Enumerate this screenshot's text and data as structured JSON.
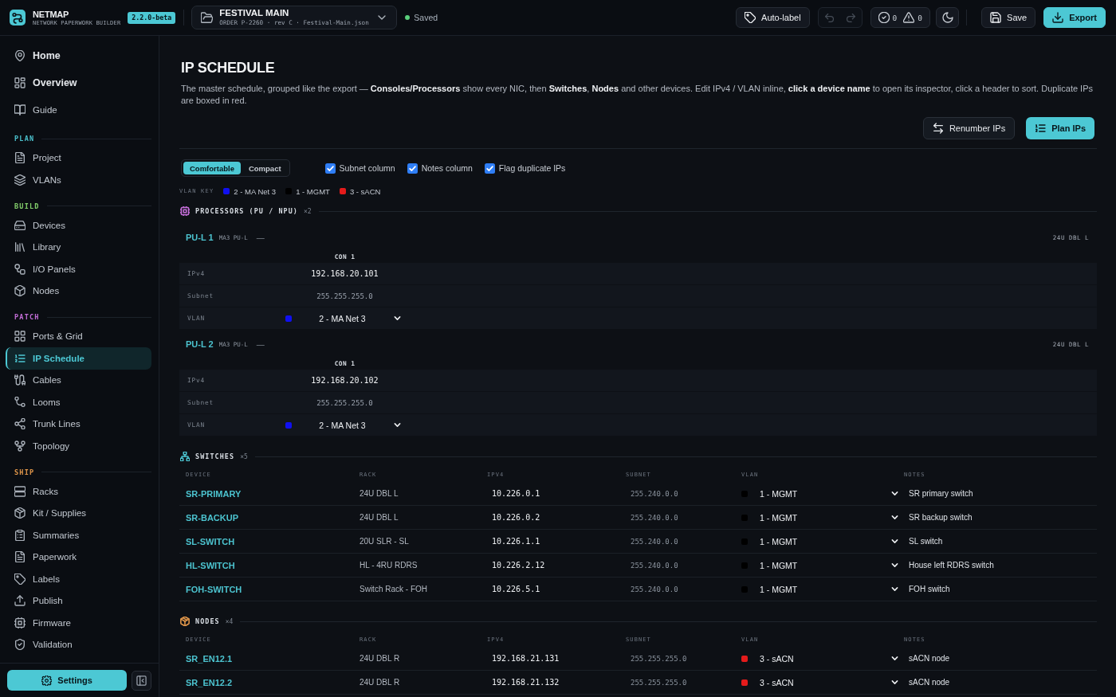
{
  "app_header": {
    "brand": {
      "name": "NETMAP",
      "tagline": "NETWORK PAPERWORK BUILDER",
      "version": "2.2.0-beta"
    },
    "project": {
      "title": "FESTIVAL MAIN",
      "details": "ORDER P-2260 · rev C · Festival-Main.json"
    },
    "save_status": {
      "label": "Saved",
      "saved": true
    },
    "actions": {
      "auto_label": "Auto-label",
      "undo": {
        "disabled": true
      },
      "redo": {
        "disabled": true
      },
      "checks": {
        "passed": "0",
        "warnings": "0"
      },
      "save": "Save",
      "export": "Export"
    }
  },
  "sidebar": {
    "top_items": [
      {
        "label": "Home",
        "kind": "primary",
        "selected": false
      },
      {
        "label": "Overview",
        "kind": "primary",
        "selected": false
      },
      {
        "label": "Guide",
        "kind": "secondary",
        "selected": false
      }
    ],
    "groups": [
      {
        "title": "PLAN",
        "color": "#4cc3cf",
        "items": [
          {
            "label": "Project",
            "selected": false
          },
          {
            "label": "VLANs",
            "selected": false
          }
        ]
      },
      {
        "title": "BUILD",
        "color": "#84d06c",
        "items": [
          {
            "label": "Devices",
            "selected": false
          },
          {
            "label": "Library",
            "selected": false
          },
          {
            "label": "I/O Panels",
            "selected": false
          },
          {
            "label": "Nodes",
            "selected": false
          }
        ]
      },
      {
        "title": "PATCH",
        "color": "#c46ed8",
        "items": [
          {
            "label": "Ports & Grid",
            "selected": false
          },
          {
            "label": "IP Schedule",
            "selected": true
          },
          {
            "label": "Cables",
            "selected": false
          },
          {
            "label": "Looms",
            "selected": false
          },
          {
            "label": "Trunk Lines",
            "selected": false
          },
          {
            "label": "Topology",
            "selected": false
          }
        ]
      },
      {
        "title": "SHIP",
        "color": "#e0964a",
        "items": [
          {
            "label": "Racks",
            "selected": false
          },
          {
            "label": "Kit / Supplies",
            "selected": false
          },
          {
            "label": "Summaries",
            "selected": false
          },
          {
            "label": "Paperwork",
            "selected": false
          },
          {
            "label": "Labels",
            "selected": false
          },
          {
            "label": "Publish",
            "selected": false
          },
          {
            "label": "Firmware",
            "selected": false
          },
          {
            "label": "Validation",
            "selected": false
          }
        ]
      }
    ],
    "settings": "Settings"
  },
  "page": {
    "title": "IP SCHEDULE",
    "description": "The master schedule, grouped like the export — **Consoles/Processors** show every NIC, then **Switches**, **Nodes** and other devices. Edit IPv4 / VLAN inline, **click a device name** to open its inspector, click a header to sort. Duplicate IPs are boxed in red.",
    "actions": [
      {
        "label": "Renumber IPs",
        "kind": "secondary"
      },
      {
        "label": "Plan IPs",
        "kind": "primary"
      }
    ]
  },
  "view_options": {
    "density": [
      {
        "label": "Comfortable",
        "selected": true
      },
      {
        "label": "Compact",
        "selected": false
      }
    ],
    "toggles": [
      {
        "label": "Subnet column",
        "checked": true
      },
      {
        "label": "Notes column",
        "checked": true
      },
      {
        "label": "Flag duplicate IPs",
        "checked": true
      }
    ]
  },
  "vlan_key": {
    "label": "VLAN KEY",
    "items": [
      {
        "label": "2 - MA Net 3",
        "color": "#1010f0"
      },
      {
        "label": "1 - MGMT",
        "color": "#000000"
      },
      {
        "label": "3 - sACN",
        "color": "#e41b1b"
      }
    ]
  },
  "sections": [
    {
      "kind": "nic_grid",
      "title": "PROCESSORS (PU / NPU)",
      "count": "×2",
      "color": "#c46ed8",
      "devices": [
        {
          "name": "PU-L 1",
          "model": "MA3 PU-L",
          "detail": "—",
          "rack": "24U DBL L",
          "row_labels": [
            "IPv4",
            "Subnet",
            "VLAN"
          ],
          "nics": [
            {
              "label": "CON 1",
              "ipv4": "192.168.20.101",
              "subnet": "255.255.255.0",
              "vlan": {
                "label": "2 - MA Net 3",
                "color": "#1010f0"
              }
            }
          ]
        },
        {
          "name": "PU-L 2",
          "model": "MA3 PU-L",
          "detail": "—",
          "rack": "24U DBL L",
          "row_labels": [
            "IPv4",
            "Subnet",
            "VLAN"
          ],
          "nics": [
            {
              "label": "CON 1",
              "ipv4": "192.168.20.102",
              "subnet": "255.255.255.0",
              "vlan": {
                "label": "2 - MA Net 3",
                "color": "#1010f0"
              }
            }
          ]
        }
      ]
    },
    {
      "kind": "table",
      "title": "SWITCHES",
      "count": "×5",
      "color": "#4cc3cf",
      "columns": [
        "DEVICE",
        "RACK",
        "IPV4",
        "SUBNET",
        "VLAN",
        "NOTES"
      ],
      "rows": [
        {
          "device": "SR-PRIMARY",
          "rack": "24U DBL L",
          "ipv4": "10.226.0.1",
          "subnet": "255.240.0.0",
          "vlan": {
            "label": "1 - MGMT",
            "color": "#000000"
          },
          "notes": "SR primary switch"
        },
        {
          "device": "SR-BACKUP",
          "rack": "24U DBL L",
          "ipv4": "10.226.0.2",
          "subnet": "255.240.0.0",
          "vlan": {
            "label": "1 - MGMT",
            "color": "#000000"
          },
          "notes": "SR backup switch"
        },
        {
          "device": "SL-SWITCH",
          "rack": "20U SLR - SL",
          "ipv4": "10.226.1.1",
          "subnet": "255.240.0.0",
          "vlan": {
            "label": "1 - MGMT",
            "color": "#000000"
          },
          "notes": "SL switch"
        },
        {
          "device": "HL-SWITCH",
          "rack": "HL - 4RU RDRS",
          "ipv4": "10.226.2.12",
          "subnet": "255.240.0.0",
          "vlan": {
            "label": "1 - MGMT",
            "color": "#000000"
          },
          "notes": "House left RDRS switch"
        },
        {
          "device": "FOH-SWITCH",
          "rack": "Switch Rack - FOH",
          "ipv4": "10.226.5.1",
          "subnet": "255.240.0.0",
          "vlan": {
            "label": "1 - MGMT",
            "color": "#000000"
          },
          "notes": "FOH switch"
        }
      ]
    },
    {
      "kind": "table",
      "title": "NODES",
      "count": "×4",
      "color": "#e0964a",
      "columns": [
        "DEVICE",
        "RACK",
        "IPV4",
        "SUBNET",
        "VLAN",
        "NOTES"
      ],
      "rows": [
        {
          "device": "SR_EN12.1",
          "rack": "24U DBL R",
          "ipv4": "192.168.21.131",
          "subnet": "255.255.255.0",
          "vlan": {
            "label": "3 - sACN",
            "color": "#e41b1b"
          },
          "notes": "sACN node"
        },
        {
          "device": "SR_EN12.2",
          "rack": "24U DBL R",
          "ipv4": "192.168.21.132",
          "subnet": "255.255.255.0",
          "vlan": {
            "label": "3 - sACN",
            "color": "#e41b1b"
          },
          "notes": "sACN node"
        }
      ]
    }
  ]
}
